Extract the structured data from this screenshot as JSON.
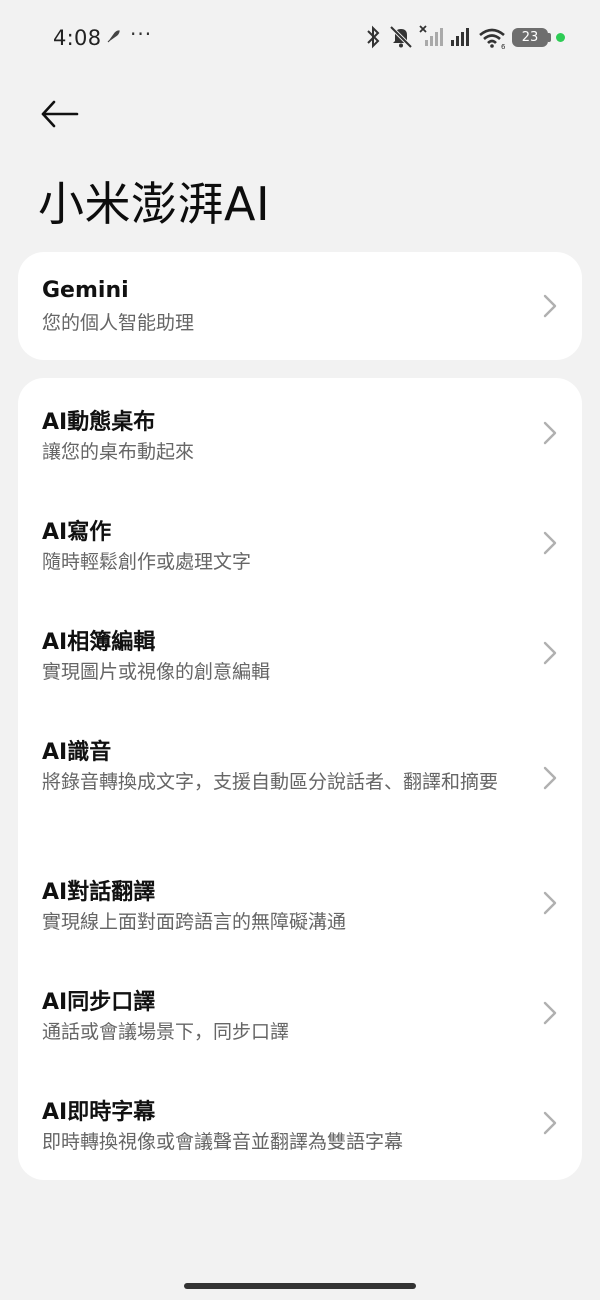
{
  "status_bar": {
    "time": "4:08",
    "more_indicator": "···",
    "battery_level": "23",
    "icons": [
      "rocket-icon",
      "bluetooth-icon",
      "muted-bell-icon",
      "no-signal-icon",
      "signal-icon",
      "wifi-icon",
      "battery-icon"
    ],
    "accent_dot_color": "#2ecc55"
  },
  "header": {
    "back_icon": "arrow-left-icon",
    "title": "小米澎湃AI"
  },
  "gemini_card": {
    "title": "Gemini",
    "subtitle": "您的個人智能助理"
  },
  "features": [
    {
      "title": "AI動態桌布",
      "subtitle": "讓您的桌布動起來"
    },
    {
      "title": "AI寫作",
      "subtitle": "隨時輕鬆創作或處理文字"
    },
    {
      "title": "AI相簿編輯",
      "subtitle": "實現圖片或視像的創意編輯"
    },
    {
      "title": "AI識音",
      "subtitle": "將錄音轉換成文字，支援自動區分說話者、翻譯和摘要"
    },
    {
      "title": "AI對話翻譯",
      "subtitle": "實現線上面對面跨語言的無障礙溝通"
    },
    {
      "title": "AI同步口譯",
      "subtitle": "通話或會議場景下，同步口譯"
    },
    {
      "title": "AI即時字幕",
      "subtitle": "即時轉換視像或會議聲音並翻譯為雙語字幕"
    }
  ],
  "colors": {
    "background": "#f2f2f2",
    "card": "#ffffff",
    "title_text": "#111111",
    "subtitle_text": "#666666",
    "chevron": "#b0b0b0"
  }
}
